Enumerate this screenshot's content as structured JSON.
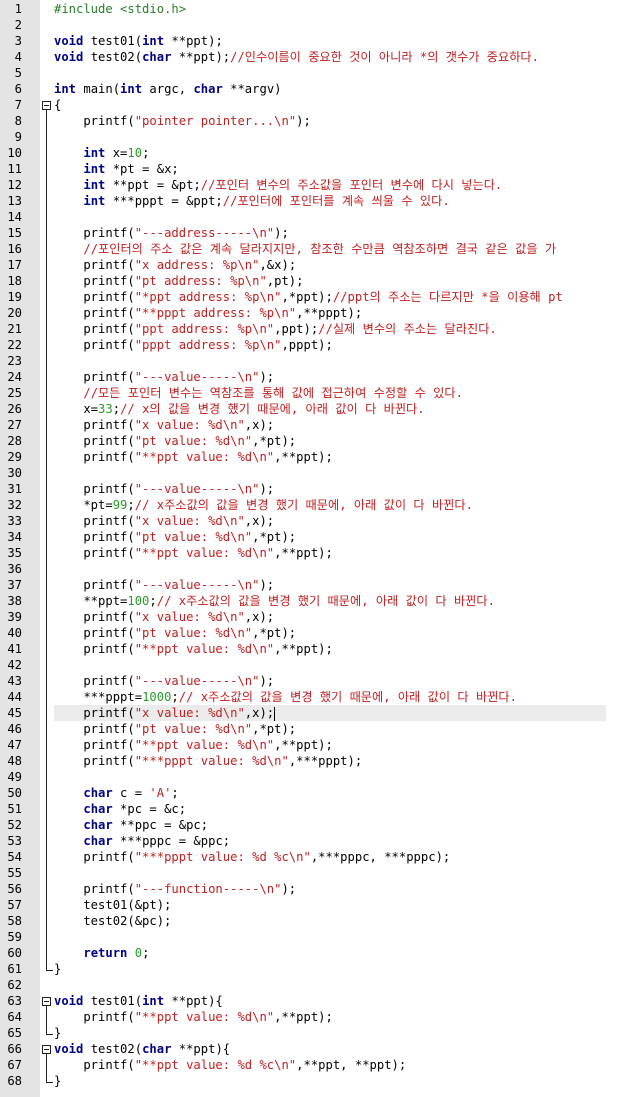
{
  "editor": {
    "current_line": 45,
    "lines": [
      {
        "n": "1",
        "fold": "",
        "segs": [
          [
            "pp",
            "#include <stdio.h>"
          ]
        ]
      },
      {
        "n": "2",
        "fold": "",
        "segs": []
      },
      {
        "n": "3",
        "fold": "",
        "segs": [
          [
            "kw",
            "void"
          ],
          [
            "",
            " test01("
          ],
          [
            "kw",
            "int"
          ],
          [
            "",
            " **ppt);"
          ]
        ]
      },
      {
        "n": "4",
        "fold": "",
        "segs": [
          [
            "kw",
            "void"
          ],
          [
            "",
            " test02("
          ],
          [
            "kw",
            "char"
          ],
          [
            "",
            " **ppt);"
          ],
          [
            "cm",
            "//인수이름이 중요한 것이 아니라 *의 갯수가 중요하다."
          ]
        ]
      },
      {
        "n": "5",
        "fold": "",
        "segs": []
      },
      {
        "n": "6",
        "fold": "",
        "segs": [
          [
            "kw",
            "int"
          ],
          [
            "",
            " main("
          ],
          [
            "kw",
            "int"
          ],
          [
            "",
            " argc, "
          ],
          [
            "kw",
            "char"
          ],
          [
            "",
            " **argv)"
          ]
        ]
      },
      {
        "n": "7",
        "fold": "open",
        "segs": [
          [
            "",
            "{"
          ]
        ]
      },
      {
        "n": "8",
        "fold": "line",
        "segs": [
          [
            "",
            "    printf("
          ],
          [
            "str",
            "\"pointer pointer...\\n\""
          ],
          [
            "",
            ");"
          ]
        ]
      },
      {
        "n": "9",
        "fold": "line",
        "segs": []
      },
      {
        "n": "10",
        "fold": "line",
        "segs": [
          [
            "",
            "    "
          ],
          [
            "kw",
            "int"
          ],
          [
            "",
            " x="
          ],
          [
            "num",
            "10"
          ],
          [
            "",
            ";"
          ]
        ]
      },
      {
        "n": "11",
        "fold": "line",
        "segs": [
          [
            "",
            "    "
          ],
          [
            "kw",
            "int"
          ],
          [
            "",
            " *pt = &x;"
          ]
        ]
      },
      {
        "n": "12",
        "fold": "line",
        "segs": [
          [
            "",
            "    "
          ],
          [
            "kw",
            "int"
          ],
          [
            "",
            " **ppt = &pt;"
          ],
          [
            "cm",
            "//포인터 변수의 주소값을 포인터 변수에 다시 넣는다."
          ]
        ]
      },
      {
        "n": "13",
        "fold": "line",
        "segs": [
          [
            "",
            "    "
          ],
          [
            "kw",
            "int"
          ],
          [
            "",
            " ***pppt = &ppt;"
          ],
          [
            "cm",
            "//포인터에 포인터를 계속 씌울 수 있다."
          ]
        ]
      },
      {
        "n": "14",
        "fold": "line",
        "segs": []
      },
      {
        "n": "15",
        "fold": "line",
        "segs": [
          [
            "",
            "    printf("
          ],
          [
            "str",
            "\"---address-----\\n\""
          ],
          [
            "",
            ");"
          ]
        ]
      },
      {
        "n": "16",
        "fold": "line",
        "segs": [
          [
            "",
            "    "
          ],
          [
            "cm",
            "//포인터의 주소 값은 계속 달라지지만, 참조한 수만큼 역참조하면 결국 같은 값을 가"
          ]
        ]
      },
      {
        "n": "17",
        "fold": "line",
        "segs": [
          [
            "",
            "    printf("
          ],
          [
            "str",
            "\"x address: %p\\n\""
          ],
          [
            "",
            ",&x);"
          ]
        ]
      },
      {
        "n": "18",
        "fold": "line",
        "segs": [
          [
            "",
            "    printf("
          ],
          [
            "str",
            "\"pt address: %p\\n\""
          ],
          [
            "",
            ",pt);"
          ]
        ]
      },
      {
        "n": "19",
        "fold": "line",
        "segs": [
          [
            "",
            "    printf("
          ],
          [
            "str",
            "\"*ppt address: %p\\n\""
          ],
          [
            "",
            ",*ppt);"
          ],
          [
            "cm",
            "//ppt의 주소는 다르지만 *을 이용해 pt"
          ]
        ]
      },
      {
        "n": "20",
        "fold": "line",
        "segs": [
          [
            "",
            "    printf("
          ],
          [
            "str",
            "\"**pppt address: %p\\n\""
          ],
          [
            "",
            ",**pppt);"
          ]
        ]
      },
      {
        "n": "21",
        "fold": "line",
        "segs": [
          [
            "",
            "    printf("
          ],
          [
            "str",
            "\"ppt address: %p\\n\""
          ],
          [
            "",
            ",ppt);"
          ],
          [
            "cm",
            "//실제 변수의 주소는 달라진다."
          ]
        ]
      },
      {
        "n": "22",
        "fold": "line",
        "segs": [
          [
            "",
            "    printf("
          ],
          [
            "str",
            "\"pppt address: %p\\n\""
          ],
          [
            "",
            ",pppt);"
          ]
        ]
      },
      {
        "n": "23",
        "fold": "line",
        "segs": []
      },
      {
        "n": "24",
        "fold": "line",
        "segs": [
          [
            "",
            "    printf("
          ],
          [
            "str",
            "\"---value-----\\n\""
          ],
          [
            "",
            ");"
          ]
        ]
      },
      {
        "n": "25",
        "fold": "line",
        "segs": [
          [
            "",
            "    "
          ],
          [
            "cm",
            "//모든 포인터 변수는 역참조를 통해 값에 접근하여 수정할 수 있다."
          ]
        ]
      },
      {
        "n": "26",
        "fold": "line",
        "segs": [
          [
            "",
            "    x="
          ],
          [
            "num",
            "33"
          ],
          [
            "",
            ";"
          ],
          [
            "cm",
            "// x의 값을 변경 했기 때문에, 아래 값이 다 바뀐다."
          ]
        ]
      },
      {
        "n": "27",
        "fold": "line",
        "segs": [
          [
            "",
            "    printf("
          ],
          [
            "str",
            "\"x value: %d\\n\""
          ],
          [
            "",
            ",x);"
          ]
        ]
      },
      {
        "n": "28",
        "fold": "line",
        "segs": [
          [
            "",
            "    printf("
          ],
          [
            "str",
            "\"pt value: %d\\n\""
          ],
          [
            "",
            ",*pt);"
          ]
        ]
      },
      {
        "n": "29",
        "fold": "line",
        "segs": [
          [
            "",
            "    printf("
          ],
          [
            "str",
            "\"**ppt value: %d\\n\""
          ],
          [
            "",
            ",**ppt);"
          ]
        ]
      },
      {
        "n": "30",
        "fold": "line",
        "segs": []
      },
      {
        "n": "31",
        "fold": "line",
        "segs": [
          [
            "",
            "    printf("
          ],
          [
            "str",
            "\"---value-----\\n\""
          ],
          [
            "",
            ");"
          ]
        ]
      },
      {
        "n": "32",
        "fold": "line",
        "segs": [
          [
            "",
            "    *pt="
          ],
          [
            "num",
            "99"
          ],
          [
            "",
            ";"
          ],
          [
            "cm",
            "// x주소값의 값을 변경 했기 때문에, 아래 값이 다 바뀐다."
          ]
        ]
      },
      {
        "n": "33",
        "fold": "line",
        "segs": [
          [
            "",
            "    printf("
          ],
          [
            "str",
            "\"x value: %d\\n\""
          ],
          [
            "",
            ",x);"
          ]
        ]
      },
      {
        "n": "34",
        "fold": "line",
        "segs": [
          [
            "",
            "    printf("
          ],
          [
            "str",
            "\"pt value: %d\\n\""
          ],
          [
            "",
            ",*pt);"
          ]
        ]
      },
      {
        "n": "35",
        "fold": "line",
        "segs": [
          [
            "",
            "    printf("
          ],
          [
            "str",
            "\"**ppt value: %d\\n\""
          ],
          [
            "",
            ",**ppt);"
          ]
        ]
      },
      {
        "n": "36",
        "fold": "line",
        "segs": []
      },
      {
        "n": "37",
        "fold": "line",
        "segs": [
          [
            "",
            "    printf("
          ],
          [
            "str",
            "\"---value-----\\n\""
          ],
          [
            "",
            ");"
          ]
        ]
      },
      {
        "n": "38",
        "fold": "line",
        "segs": [
          [
            "",
            "    **ppt="
          ],
          [
            "num",
            "100"
          ],
          [
            "",
            ";"
          ],
          [
            "cm",
            "// x주소값의 값을 변경 했기 때문에, 아래 값이 다 바뀐다."
          ]
        ]
      },
      {
        "n": "39",
        "fold": "line",
        "segs": [
          [
            "",
            "    printf("
          ],
          [
            "str",
            "\"x value: %d\\n\""
          ],
          [
            "",
            ",x);"
          ]
        ]
      },
      {
        "n": "40",
        "fold": "line",
        "segs": [
          [
            "",
            "    printf("
          ],
          [
            "str",
            "\"pt value: %d\\n\""
          ],
          [
            "",
            ",*pt);"
          ]
        ]
      },
      {
        "n": "41",
        "fold": "line",
        "segs": [
          [
            "",
            "    printf("
          ],
          [
            "str",
            "\"**ppt value: %d\\n\""
          ],
          [
            "",
            ",**ppt);"
          ]
        ]
      },
      {
        "n": "42",
        "fold": "line",
        "segs": []
      },
      {
        "n": "43",
        "fold": "line",
        "segs": [
          [
            "",
            "    printf("
          ],
          [
            "str",
            "\"---value-----\\n\""
          ],
          [
            "",
            ");"
          ]
        ]
      },
      {
        "n": "44",
        "fold": "line",
        "segs": [
          [
            "",
            "    ***pppt="
          ],
          [
            "num",
            "1000"
          ],
          [
            "",
            ";"
          ],
          [
            "cm",
            "// x주소값의 값을 변경 했기 때문에, 아래 값이 다 바뀐다."
          ]
        ]
      },
      {
        "n": "45",
        "fold": "line",
        "segs": [
          [
            "",
            "    printf("
          ],
          [
            "str",
            "\"x value: %d\\n\""
          ],
          [
            "",
            ",x);"
          ],
          [
            "caret",
            ""
          ]
        ]
      },
      {
        "n": "46",
        "fold": "line",
        "segs": [
          [
            "",
            "    printf("
          ],
          [
            "str",
            "\"pt value: %d\\n\""
          ],
          [
            "",
            ",*pt);"
          ]
        ]
      },
      {
        "n": "47",
        "fold": "line",
        "segs": [
          [
            "",
            "    printf("
          ],
          [
            "str",
            "\"**ppt value: %d\\n\""
          ],
          [
            "",
            ",**ppt);"
          ]
        ]
      },
      {
        "n": "48",
        "fold": "line",
        "segs": [
          [
            "",
            "    printf("
          ],
          [
            "str",
            "\"***pppt value: %d\\n\""
          ],
          [
            "",
            ",***pppt);"
          ]
        ]
      },
      {
        "n": "49",
        "fold": "line",
        "segs": []
      },
      {
        "n": "50",
        "fold": "line",
        "segs": [
          [
            "",
            "    "
          ],
          [
            "kw",
            "char"
          ],
          [
            "",
            " c = "
          ],
          [
            "str",
            "'A'"
          ],
          [
            "",
            ";"
          ]
        ]
      },
      {
        "n": "51",
        "fold": "line",
        "segs": [
          [
            "",
            "    "
          ],
          [
            "kw",
            "char"
          ],
          [
            "",
            " *pc = &c;"
          ]
        ]
      },
      {
        "n": "52",
        "fold": "line",
        "segs": [
          [
            "",
            "    "
          ],
          [
            "kw",
            "char"
          ],
          [
            "",
            " **ppc = &pc;"
          ]
        ]
      },
      {
        "n": "53",
        "fold": "line",
        "segs": [
          [
            "",
            "    "
          ],
          [
            "kw",
            "char"
          ],
          [
            "",
            " ***pppc = &ppc;"
          ]
        ]
      },
      {
        "n": "54",
        "fold": "line",
        "segs": [
          [
            "",
            "    printf("
          ],
          [
            "str",
            "\"***pppt value: %d %c\\n\""
          ],
          [
            "",
            ",***pppc, ***pppc);"
          ]
        ]
      },
      {
        "n": "55",
        "fold": "line",
        "segs": []
      },
      {
        "n": "56",
        "fold": "line",
        "segs": [
          [
            "",
            "    printf("
          ],
          [
            "str",
            "\"---function-----\\n\""
          ],
          [
            "",
            ");"
          ]
        ]
      },
      {
        "n": "57",
        "fold": "line",
        "segs": [
          [
            "",
            "    test01(&pt);"
          ]
        ]
      },
      {
        "n": "58",
        "fold": "line",
        "segs": [
          [
            "",
            "    test02(&pc);"
          ]
        ]
      },
      {
        "n": "59",
        "fold": "line",
        "segs": []
      },
      {
        "n": "60",
        "fold": "line",
        "segs": [
          [
            "",
            "    "
          ],
          [
            "kw",
            "return"
          ],
          [
            "",
            " "
          ],
          [
            "num",
            "0"
          ],
          [
            "",
            ";"
          ]
        ]
      },
      {
        "n": "61",
        "fold": "end",
        "segs": [
          [
            "",
            "}"
          ]
        ]
      },
      {
        "n": "62",
        "fold": "",
        "segs": []
      },
      {
        "n": "63",
        "fold": "open",
        "segs": [
          [
            "kw",
            "void"
          ],
          [
            "",
            " test01("
          ],
          [
            "kw",
            "int"
          ],
          [
            "",
            " **ppt){"
          ]
        ]
      },
      {
        "n": "64",
        "fold": "line",
        "segs": [
          [
            "",
            "    printf("
          ],
          [
            "str",
            "\"**ppt value: %d\\n\""
          ],
          [
            "",
            ",**ppt);"
          ]
        ]
      },
      {
        "n": "65",
        "fold": "end",
        "segs": [
          [
            "",
            "}"
          ]
        ]
      },
      {
        "n": "66",
        "fold": "open",
        "segs": [
          [
            "kw",
            "void"
          ],
          [
            "",
            " test02("
          ],
          [
            "kw",
            "char"
          ],
          [
            "",
            " **ppt){"
          ]
        ]
      },
      {
        "n": "67",
        "fold": "line",
        "segs": [
          [
            "",
            "    printf("
          ],
          [
            "str",
            "\"**ppt value: %d %c\\n\""
          ],
          [
            "",
            ",**ppt, **ppt);"
          ]
        ]
      },
      {
        "n": "68",
        "fold": "end",
        "segs": [
          [
            "",
            "}"
          ]
        ]
      }
    ]
  }
}
